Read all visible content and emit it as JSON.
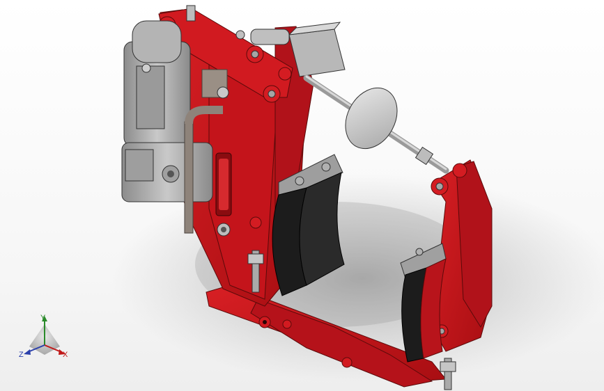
{
  "viewport": {
    "background": "#ffffff",
    "part_color": "#c8151b",
    "motor_color": "#a9a9a9"
  },
  "triad": {
    "x_label": "X",
    "y_label": "Y",
    "z_label": "Z",
    "x_color": "#c01818",
    "y_color": "#2a8a2a",
    "z_color": "#2a3faa"
  }
}
